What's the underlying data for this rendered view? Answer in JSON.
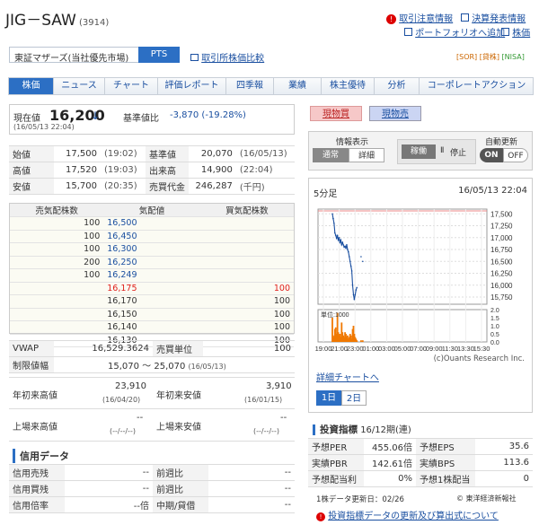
{
  "header": {
    "title": "JIG－SAW",
    "code": "(3914)",
    "links": [
      "取引注意情報",
      "決算発表情報",
      "ポートフォリオへ追加",
      "株価"
    ],
    "market": "東証マザーズ(当社優先市場)",
    "pts": "PTS",
    "compare": "取引所株価比較",
    "badges": [
      "[SOR]",
      "[貸株]",
      "[NISA]"
    ]
  },
  "tabs": [
    "株価",
    "ニュース",
    "チャート",
    "評価レポート",
    "四季報",
    "業績",
    "株主優待",
    "分析",
    "コーポレートアクション"
  ],
  "price": {
    "label": "現在値",
    "value": "16,200",
    "arrow": "↓",
    "time": "(16/05/13 22:04)",
    "change_label": "基準値比",
    "change": "-3,870 (-19.28%)"
  },
  "trade_buttons": {
    "buy": "現物買",
    "sell": "現物売"
  },
  "stats": [
    {
      "l1": "始値",
      "v1": "17,500",
      "t1": "(19:02)",
      "l2": "基準値",
      "v2": "20,070",
      "t2": "(16/05/13)"
    },
    {
      "l1": "高値",
      "v1": "17,520",
      "t1": "(19:03)",
      "l2": "出来高",
      "v2": "14,900",
      "t2": "(22:04)"
    },
    {
      "l1": "安値",
      "v1": "15,700",
      "t1": "(20:35)",
      "l2": "売買代金",
      "v2": "246,287",
      "t2": "(千円)"
    }
  ],
  "orderbook": {
    "headers": [
      "売気配株数",
      "気配値",
      "買気配株数"
    ],
    "rows": [
      {
        "sell": "100",
        "price": "16,500",
        "buy": ""
      },
      {
        "sell": "100",
        "price": "16,450",
        "buy": ""
      },
      {
        "sell": "100",
        "price": "16,300",
        "buy": ""
      },
      {
        "sell": "200",
        "price": "16,250",
        "buy": ""
      },
      {
        "sell": "100",
        "price": "16,249",
        "buy": ""
      },
      {
        "sell": "",
        "price": "16,175",
        "buy": "100"
      },
      {
        "sell": "",
        "price": "16,170",
        "buy": "100"
      },
      {
        "sell": "",
        "price": "16,150",
        "buy": "100"
      },
      {
        "sell": "",
        "price": "16,140",
        "buy": "100"
      },
      {
        "sell": "",
        "price": "16,130",
        "buy": "100"
      }
    ]
  },
  "vwap": {
    "label": "VWAP",
    "value": "16,529.3624",
    "unit_label": "売買単位",
    "unit": "100"
  },
  "limit": {
    "label": "制限値幅",
    "value": "15,070 ～ 25,070",
    "date": "(16/05/13)"
  },
  "yearly": {
    "high_label": "年初来高値",
    "high": "23,910",
    "high_date": "(16/04/20)",
    "low_label": "年初来安値",
    "low": "3,910",
    "low_date": "(16/01/15)"
  },
  "listing": {
    "high_label": "上場来高値",
    "high": "--",
    "high_date": "(--/--/--)",
    "low_label": "上場来安値",
    "low": "--",
    "low_date": "(--/--/--)"
  },
  "credit": {
    "title": "信用データ",
    "rows": [
      {
        "l1": "信用売残",
        "v1": "--",
        "l2": "前週比",
        "v2": "--"
      },
      {
        "l1": "信用買残",
        "v1": "--",
        "l2": "前週比",
        "v2": "--"
      },
      {
        "l1": "信用倍率",
        "v1": "--倍",
        "l2": "中期/貸借",
        "v2": "--"
      }
    ]
  },
  "info_panel": {
    "display_label": "情報表示",
    "normal": "通常",
    "detail": "詳細",
    "active": "稼働",
    "stop": "停止",
    "auto_label": "自動更新",
    "on": "ON",
    "off": "OFF"
  },
  "chart_data": {
    "type": "line",
    "title": "5分足",
    "timestamp": "16/05/13 22:04",
    "ylim": [
      15600,
      17600
    ],
    "yticks": [
      "17,500",
      "17,250",
      "17,000",
      "16,750",
      "16,500",
      "16,250",
      "16,000",
      "15,750"
    ],
    "xticks": [
      "19:00",
      "21:00",
      "23:00",
      "01:00",
      "03:00",
      "05:00",
      "07:00",
      "09:00",
      "11:30",
      "13:30",
      "15:30"
    ],
    "x": [
      0,
      1,
      2,
      3,
      4,
      5,
      6,
      7,
      8,
      9,
      10,
      11,
      12,
      13,
      14,
      15,
      16,
      17,
      18,
      19,
      20,
      21,
      22,
      23,
      24,
      25,
      26,
      27,
      28,
      29,
      30,
      31,
      32,
      33,
      34,
      35,
      36
    ],
    "series": [
      {
        "values": [
          17500,
          17400,
          17300,
          17100,
          17050,
          16980,
          17050,
          16950,
          17000,
          16900,
          16950,
          16850,
          16900,
          16850,
          16800,
          16820,
          16780,
          16850,
          16750,
          16700,
          16600,
          16500,
          16400,
          16300,
          16000,
          15800,
          15700,
          15800,
          15900,
          15950,
          null,
          null,
          null,
          null,
          16600,
          null,
          16500
        ]
      }
    ],
    "volume_label": "単位:1000",
    "volume_ticks": [
      "2.0",
      "1.5",
      "1.0",
      "0.5",
      "0.0"
    ],
    "volume": [
      1.5,
      0.4,
      0.3,
      0.8,
      0.9,
      0.5,
      1.8,
      0.6,
      0.4,
      0.5,
      0.3,
      1.2,
      0.6,
      0.4,
      0.3,
      0.6,
      0.5,
      0.3,
      0.4,
      0.2,
      0.3,
      0.5,
      0.4,
      0.2,
      0.8,
      1.0,
      0.5,
      0.3,
      0.2,
      0.1,
      0,
      0,
      0,
      0,
      0.1,
      0,
      0.1
    ],
    "credit": "(c)Ouants Research Inc.",
    "link": "詳細チャートへ",
    "ranges": [
      "1日",
      "2日"
    ]
  },
  "indicators": {
    "title": "投資指標",
    "period": "16/12期(連)",
    "rows": [
      {
        "l1": "予想PER",
        "v1": "455.06倍",
        "l2": "予想EPS",
        "v2": "35.6"
      },
      {
        "l1": "実績PBR",
        "v1": "142.61倍",
        "l2": "実績BPS",
        "v2": "113.6"
      },
      {
        "l1": "予想配当利",
        "v1": "0%",
        "l2": "予想1株配当",
        "v2": "0"
      }
    ],
    "update": "1株データ更新日：02/26",
    "source": "© 東洋経済新報社",
    "note": "投資指標データの更新及び算出式について"
  },
  "colors": {
    "accent": "#1a4fa0",
    "red": "#e0201b",
    "orange": "#f07800"
  }
}
